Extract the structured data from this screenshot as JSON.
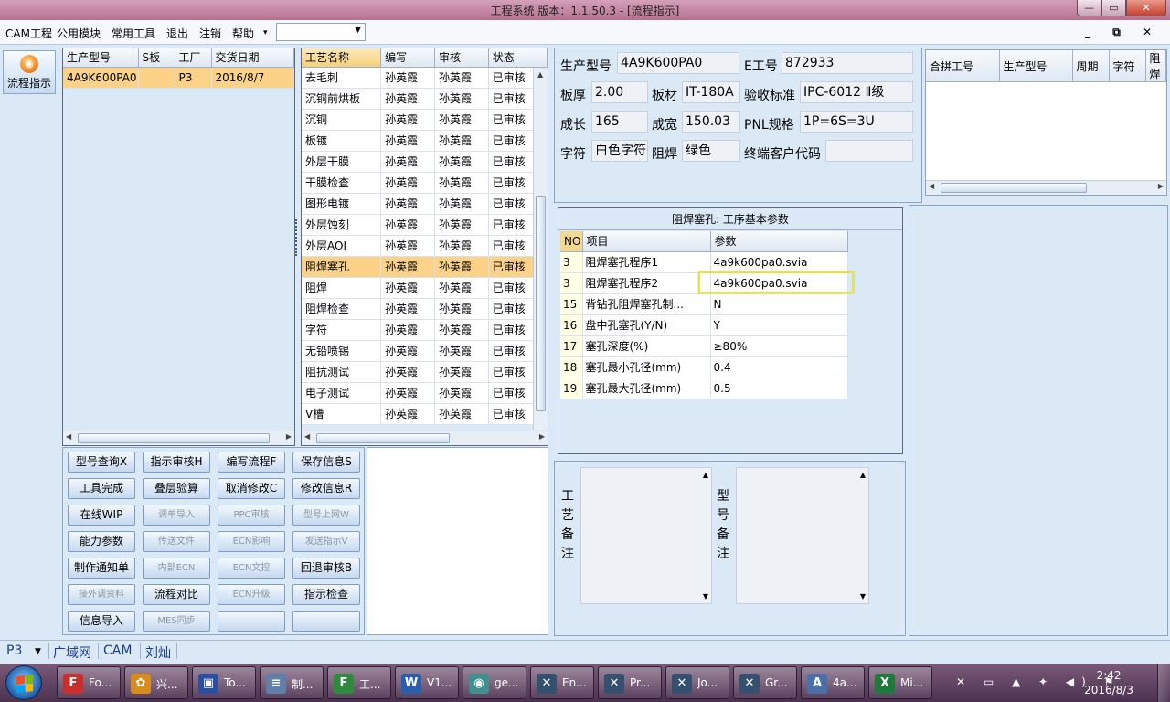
{
  "window": {
    "title": "工程系统   版本：1.1.50.3 - [流程指示]",
    "min": "—",
    "max": "▭",
    "close": "✕"
  },
  "menu": {
    "items": [
      "CAM工程",
      "公用模块",
      "常用工具",
      "退出",
      "注销",
      "帮助"
    ],
    "help_arrow": "▾",
    "combo_value": "",
    "mdi": "_ ⧉ ✕"
  },
  "launcher": {
    "label": "流程指示"
  },
  "orders": {
    "columns": [
      "生产型号",
      "S板",
      "工厂",
      "交货日期"
    ],
    "rows": [
      {
        "model": "4A9K600PA0",
        "s": "",
        "factory": "P3",
        "date": "2016/8/7"
      }
    ]
  },
  "process": {
    "columns": [
      "工艺名称",
      "编写",
      "审核",
      "状态"
    ],
    "rows": [
      [
        "去毛刺",
        "孙英霞",
        "孙英霞",
        "已审核"
      ],
      [
        "沉铜前烘板",
        "孙英霞",
        "孙英霞",
        "已审核"
      ],
      [
        "沉铜",
        "孙英霞",
        "孙英霞",
        "已审核"
      ],
      [
        "板镀",
        "孙英霞",
        "孙英霞",
        "已审核"
      ],
      [
        "外层干膜",
        "孙英霞",
        "孙英霞",
        "已审核"
      ],
      [
        "干膜检查",
        "孙英霞",
        "孙英霞",
        "已审核"
      ],
      [
        "图形电镀",
        "孙英霞",
        "孙英霞",
        "已审核"
      ],
      [
        "外层蚀刻",
        "孙英霞",
        "孙英霞",
        "已审核"
      ],
      [
        "外层AOI",
        "孙英霞",
        "孙英霞",
        "已审核"
      ],
      [
        "阻焊塞孔",
        "孙英霞",
        "孙英霞",
        "已审核"
      ],
      [
        "阻焊",
        "孙英霞",
        "孙英霞",
        "已审核"
      ],
      [
        "阻焊检查",
        "孙英霞",
        "孙英霞",
        "已审核"
      ],
      [
        "字符",
        "孙英霞",
        "孙英霞",
        "已审核"
      ],
      [
        "无铅喷锡",
        "孙英霞",
        "孙英霞",
        "已审核"
      ],
      [
        "阻抗测试",
        "孙英霞",
        "孙英霞",
        "已审核"
      ],
      [
        "电子测试",
        "孙英霞",
        "孙英霞",
        "已审核"
      ],
      [
        "V槽",
        "孙英霞",
        "孙英霞",
        "已审核"
      ]
    ],
    "selected_index": 9
  },
  "buttons": [
    [
      "型号查询X",
      "指示审核H",
      "编写流程F",
      "保存信息S"
    ],
    [
      "工具完成",
      "叠层验算",
      "取消修改C",
      "修改信息R"
    ],
    [
      "在线WIP",
      "调单导入",
      "PPC审核",
      "型号上网W"
    ],
    [
      "能力参数",
      "传送文件",
      "ECN影响",
      "发送指示V"
    ],
    [
      "制作通知单",
      "内部ECN",
      "ECN文控",
      "回退审核B"
    ],
    [
      "接外调资料",
      "流程对比",
      "ECN升级",
      "指示检查"
    ],
    [
      "信息导入",
      "MES同步",
      "",
      ""
    ]
  ],
  "buttons_disabled": [
    [
      false,
      false,
      false,
      false
    ],
    [
      false,
      false,
      false,
      false
    ],
    [
      false,
      true,
      true,
      true
    ],
    [
      false,
      true,
      true,
      true
    ],
    [
      false,
      true,
      true,
      false
    ],
    [
      true,
      false,
      true,
      false
    ],
    [
      false,
      true,
      false,
      false
    ]
  ],
  "info": {
    "model_label": "生产型号",
    "model": "4A9K600PA0",
    "e_label": "E工号",
    "e_no": "872933",
    "thick_label": "板厚",
    "thick": "2.00",
    "material_label": "板材",
    "material": "IT-180A",
    "standard_label": "验收标准",
    "standard": "IPC-6012 Ⅱ级",
    "length_label": "成长",
    "length": "165",
    "width_label": "成宽",
    "width": "150.03",
    "pnl_label": "PNL规格",
    "pnl": "1P=6S=3U",
    "char_label": "字符",
    "char": "白色字符",
    "mask_label": "阻焊",
    "mask": "绿色",
    "customer_label": "终端客户代码",
    "customer": ""
  },
  "merge": {
    "columns": [
      "合拼工号",
      "生产型号",
      "周期",
      "字符",
      "阻焊"
    ]
  },
  "params": {
    "caption": "阻焊塞孔: 工序基本参数",
    "columns": [
      "NO",
      "项目",
      "参数"
    ],
    "rows": [
      [
        "3",
        "阻焊塞孔程序1",
        "4a9k600pa0.svia"
      ],
      [
        "3",
        "阻焊塞孔程序2",
        "4a9k600pa0.svia"
      ],
      [
        "15",
        "背钻孔阻焊塞孔制...",
        "N"
      ],
      [
        "16",
        "盘中孔塞孔(Y/N)",
        "Y"
      ],
      [
        "17",
        "塞孔深度(%)",
        "≥80%"
      ],
      [
        "18",
        "塞孔最小孔径(mm)",
        "0.4"
      ],
      [
        "19",
        "塞孔最大孔径(mm)",
        "0.5"
      ]
    ]
  },
  "notes": {
    "process_label": "工艺备注",
    "model_label": "型号备注"
  },
  "status": {
    "factory": "P3",
    "network": "广域网",
    "dept": "CAM",
    "user": "刘灿"
  },
  "taskbar": {
    "apps": [
      {
        "label": "Fo...",
        "color": "#c9302c",
        "glyph": "F"
      },
      {
        "label": "兴...",
        "color": "#d98b1c",
        "glyph": "✿"
      },
      {
        "label": "To...",
        "color": "#2b4f9e",
        "glyph": "▣"
      },
      {
        "label": "制...",
        "color": "#5f7fa8",
        "glyph": "≡"
      },
      {
        "label": "工...",
        "color": "#2e8a3c",
        "glyph": "F"
      },
      {
        "label": "V1...",
        "color": "#2b5fae",
        "glyph": "W"
      },
      {
        "label": "ge...",
        "color": "#3f8f8f",
        "glyph": "◉"
      },
      {
        "label": "En...",
        "color": "#35506f",
        "glyph": "✕"
      },
      {
        "label": "Pr...",
        "color": "#35506f",
        "glyph": "✕"
      },
      {
        "label": "Jo...",
        "color": "#35506f",
        "glyph": "✕"
      },
      {
        "label": "Gr...",
        "color": "#35506f",
        "glyph": "✕"
      },
      {
        "label": "4a...",
        "color": "#4b6fa8",
        "glyph": "A"
      },
      {
        "label": "Mi...",
        "color": "#1e7a3a",
        "glyph": "X"
      }
    ],
    "time": "2:42",
    "date": "2016/8/3",
    "tray_icons": "✕ ▭ ▲ ✦ ◀) ⚑"
  }
}
